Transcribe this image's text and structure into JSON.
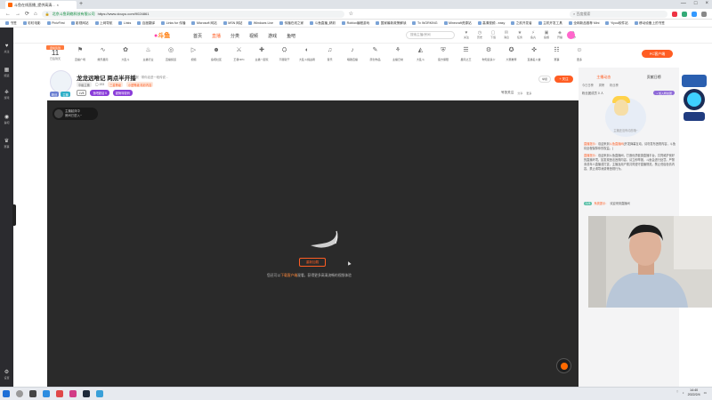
{
  "browser": {
    "tab_title": "斗鱼在线直播_提供高清...",
    "url": "https://www.douyu.com/9024861",
    "address_prefix": "北京斗鱼网络科技有限公司",
    "search_engine": "百度搜索",
    "bookmarks": [
      "书签",
      "彩虹电影",
      "PixivFirst",
      "影视网站",
      "上网导航",
      "Links",
      "百度翻译",
      "Links for 传播",
      "Microsoft 网站",
      "MSN 网站",
      "Windows Live",
      "传播在线之家",
      "斗鱼直播_精彩",
      "Roblox编程游戏",
      "国家最新政策解读",
      "Tx WORKING",
      "Minecraft资源站",
      "高清视频 - easy",
      "之前开发者",
      "主机开发工具",
      "全网新品推荐 Mini",
      "Yiyou软件站",
      "移动设备上的书签"
    ]
  },
  "rail": {
    "items": [
      {
        "icon": "♥",
        "label": "关注"
      },
      {
        "icon": "▦",
        "label": "频道"
      },
      {
        "icon": "⎈",
        "label": "游戏"
      },
      {
        "icon": "◉",
        "label": "鱼吧"
      },
      {
        "icon": "♛",
        "label": "赛事"
      },
      {
        "icon": "⚙",
        "label": "设置"
      }
    ]
  },
  "header": {
    "logo": "斗鱼",
    "nav": [
      "首页",
      "直播",
      "分类",
      "视频",
      "游戏",
      "鱼吧"
    ],
    "active_nav": "直播",
    "search_placeholder": "搜索主播/房间",
    "icons": [
      {
        "icon": "♥",
        "label": "关注"
      },
      {
        "icon": "◷",
        "label": "历史"
      },
      {
        "icon": "▢",
        "label": "下载"
      },
      {
        "icon": "✉",
        "label": "消息"
      },
      {
        "icon": "★",
        "label": "任务"
      },
      {
        "icon": "⚡",
        "label": "鱼丸"
      },
      {
        "icon": "▣",
        "label": "鱼翅"
      },
      {
        "icon": "◈",
        "label": "开播"
      },
      {
        "icon": "✦",
        "label": "创作"
      }
    ]
  },
  "categories": {
    "day_top": "连续签到",
    "day_num": "11",
    "day_label": "已签到天",
    "items": [
      {
        "icon": "⚑",
        "label": "直播广场"
      },
      {
        "icon": "∿",
        "label": "娱乐星际"
      },
      {
        "icon": "✿",
        "label": "大乱斗"
      },
      {
        "icon": "♨",
        "label": "主播行业"
      },
      {
        "icon": "◎",
        "label": "直播频道"
      },
      {
        "icon": "▷",
        "label": "视频"
      },
      {
        "icon": "☻",
        "label": "鱼吧社区"
      },
      {
        "icon": "⚔",
        "label": "王者NPC"
      },
      {
        "icon": "✚",
        "label": "主播一起玩"
      },
      {
        "icon": "⛭",
        "label": "不服就干"
      },
      {
        "icon": "◐",
        "label": "大乱斗挑战者"
      },
      {
        "icon": "♫",
        "label": "音乐"
      },
      {
        "icon": "♪",
        "label": "唱歌直播"
      },
      {
        "icon": "✎",
        "label": "原创作品"
      },
      {
        "icon": "⚘",
        "label": "主播日常"
      },
      {
        "icon": "◭",
        "label": "大乱斗"
      },
      {
        "icon": "⛨",
        "label": "官方保障"
      },
      {
        "icon": "☰",
        "label": "星际之王"
      },
      {
        "icon": "⚙",
        "label": "你知道多少"
      },
      {
        "icon": "✪",
        "label": "大赛推荐"
      },
      {
        "icon": "✜",
        "label": "直播名人堂"
      },
      {
        "icon": "☷",
        "label": "赛事"
      },
      {
        "icon": "☺",
        "label": "更多"
      }
    ],
    "pc_client": "PC客户端"
  },
  "room": {
    "title": "龙龙远唯记 两点半开播",
    "meta": "举报 · 带你走进一段传说…",
    "badge_left": "粉丝",
    "badge_right": "主播",
    "level": "LV",
    "tags": [
      "中级主播",
      "◯ 193",
      "三星等级",
      "小盛等级 精彩内容"
    ],
    "purple1": "鱼吧超话 5",
    "purple2": "超管特权码",
    "fans_pill": "LV8",
    "report": "举报",
    "follow": "+ 关注",
    "follow_count": "号张关注",
    "actions_follow": "号张关注",
    "share": "分享",
    "more": "更多"
  },
  "player": {
    "tag_line1": "主播起床中",
    "tag_line2": "房间已进入~",
    "error_button": "重新加载",
    "hint_prefix": "您还可以",
    "hint_link": "下载客户端",
    "hint_suffix": "观看，获得更多高清流畅的视频体验"
  },
  "sidebar": {
    "tabs": [
      "主播动态",
      "贡献日榜"
    ],
    "active_tab": "主播动态",
    "rank_tabs": [
      "今日日榜",
      "周榜",
      "粉丝榜"
    ],
    "fan_label": "粉丝团成员 0 人",
    "fan_button": "+ 加入粉丝团",
    "mascot_text": "主播还没有动态哦~",
    "notices": [
      {
        "tag": "直播提示：",
        "text": "欢迎来到",
        "em": "斗鱼直播间",
        "rest": "(开发弹幕互动，请勿发布违规内容，斗鱼将全程保障你的权益。)"
      },
      {
        "tag": "直播提示：",
        "text": "欢迎来到斗鱼直播间，打造优质健康直播平台，共同维护良好的直播环境。如发现违法违规内容，请立即举报，斗鱼会进行处罚。严禁未成年人直播或打赏，主播及用户需共同遵守直播规范。禁止低俗色情内容，禁止诱导消费等违规行为。",
        "em": "",
        "rest": ""
      }
    ],
    "level_badge": "LV4",
    "level_tag": "系统提示：",
    "level_text": "欢迎来到直播间"
  },
  "taskbar": {
    "time": "14:40",
    "date": "2022/2/4"
  }
}
